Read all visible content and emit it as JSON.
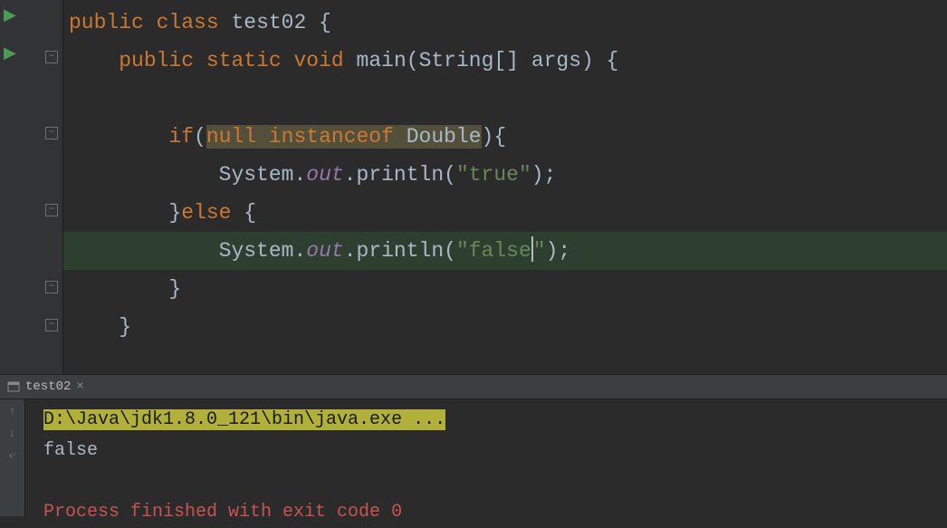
{
  "code": {
    "kw_public": "public",
    "kw_class": "class",
    "kw_static": "static",
    "kw_void": "void",
    "kw_if": "if",
    "kw_else": "else",
    "kw_null": "null",
    "kw_instanceof": "instanceof",
    "class_name": "test02",
    "method_main": "main",
    "type_string": "String",
    "param_args": "args",
    "type_double": "Double",
    "class_system": "System",
    "field_out": "out",
    "method_println": "println",
    "str_true": "\"true\"",
    "str_false": "\"false\""
  },
  "tab": {
    "name": "test02"
  },
  "console": {
    "command": "D:\\Java\\jdk1.8.0_121\\bin\\java.exe ...",
    "output": "false",
    "exit": "Process finished with exit code 0"
  }
}
